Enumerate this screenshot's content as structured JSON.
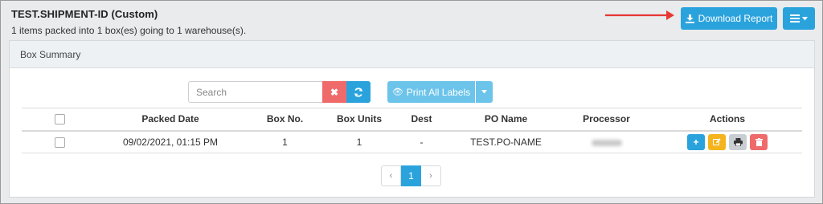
{
  "header": {
    "title": "TEST.SHIPMENT-ID (Custom)",
    "subtitle": "1 items packed into 1 box(es) going to 1 warehouse(s)."
  },
  "toolbar": {
    "download_label": "Download Report",
    "download_icon": "download-icon",
    "menu_icon": "hamburger-menu-icon"
  },
  "panel": {
    "title": "Box Summary"
  },
  "search": {
    "placeholder": "Search",
    "value": ""
  },
  "print": {
    "label": "Print All Labels"
  },
  "table": {
    "columns": [
      "Packed Date",
      "Box No.",
      "Box Units",
      "Dest",
      "PO Name",
      "Processor",
      "Actions"
    ],
    "rows": [
      {
        "packed_date": "09/02/2021, 01:15 PM",
        "box_no": "1",
        "box_units": "1",
        "dest": "-",
        "po_name": "TEST.PO-NAME"
      }
    ]
  },
  "pagination": {
    "prev": "‹",
    "current": "1",
    "next": "›"
  },
  "colors": {
    "primary": "#2aa3dd",
    "danger": "#ef6b6b",
    "warning": "#f5b41d",
    "annotation_arrow": "#e53935"
  }
}
